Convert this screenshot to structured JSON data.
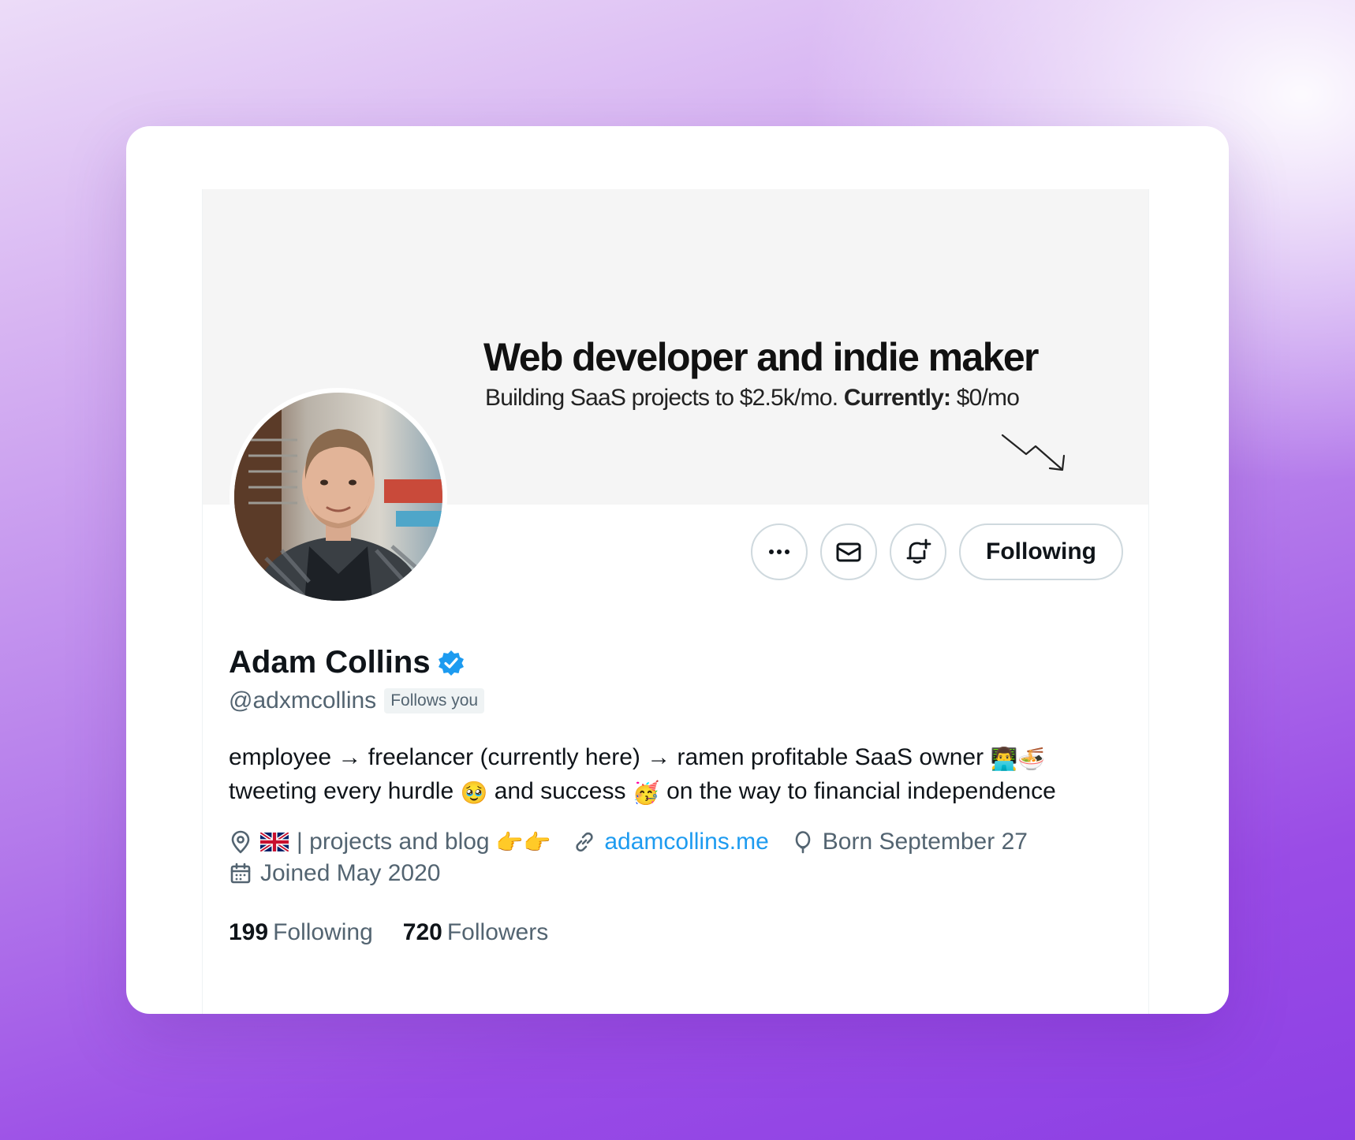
{
  "banner": {
    "title": "Web developer and indie maker",
    "subtitle_prefix": "Building SaaS projects to $2.5k/mo.",
    "subtitle_bold": "Currently:",
    "subtitle_suffix": "$0/mo"
  },
  "actions": {
    "more_icon": "more-horizontal-icon",
    "message_icon": "envelope-icon",
    "notify_icon": "bell-plus-icon",
    "follow_label": "Following"
  },
  "profile": {
    "name": "Adam Collins",
    "verified_icon": "verified-badge-icon",
    "handle": "@adxmcollins",
    "follows_badge": "Follows you",
    "bio_line1": "employee → freelancer (currently here) → ramen profitable SaaS owner",
    "bio_line1_emoji": "👨‍💻🍜",
    "bio_line2_a": "tweeting every hurdle",
    "bio_line2_emoji1": "🥹",
    "bio_line2_b": "and success",
    "bio_line2_emoji2": "🥳",
    "bio_line2_c": "on the way to financial independence",
    "location_text": "| projects and blog",
    "location_emoji": "👉👉",
    "website": "adamcollins.me",
    "birthday": "Born September 27",
    "joined": "Joined May 2020"
  },
  "stats": {
    "following_count": "199",
    "following_label": "Following",
    "followers_count": "720",
    "followers_label": "Followers"
  },
  "colors": {
    "accent": "#1d9bf0",
    "text": "#0f1419",
    "muted": "#536471"
  }
}
